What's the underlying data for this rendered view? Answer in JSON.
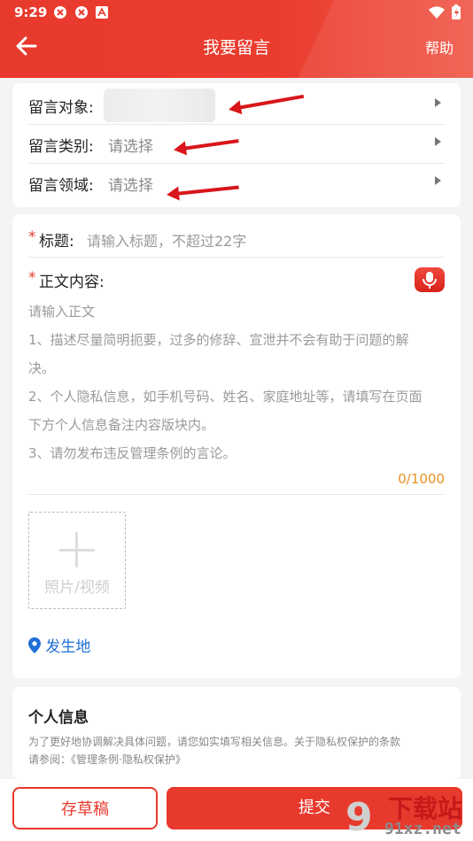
{
  "status_bar": {
    "time": "9:29"
  },
  "nav": {
    "title": "我要留言",
    "help": "帮助"
  },
  "selection": {
    "target_label": "留言对象:",
    "category_label": "留言类别:",
    "category_value": "请选择",
    "domain_label": "留言领域:",
    "domain_value": "请选择"
  },
  "content": {
    "title_label": "标题:",
    "title_placeholder": "请输入标题，不超过22字",
    "body_label": "正文内容:",
    "body_placeholder_lines": [
      "请输入正文",
      "1、描述尽量简明扼要，过多的修辞、宣泄并不会有助于问题的解",
      "决。",
      "2、个人隐私信息，如手机号码、姓名、家庭地址等，请填写在页面",
      "下方个人信息备注内容版块内。",
      "3、请勿发布违反管理条例的言论。"
    ],
    "counter": "0/1000",
    "upload_label": "照片/视频",
    "location_label": "发生地"
  },
  "personal": {
    "title": "个人信息",
    "desc_line1": "为了更好地协调解决具体问题，请您如实填写相关信息。关于隐私权保护的条款",
    "desc_line2": "请参阅：《管理条例·隐私权保护》"
  },
  "footer": {
    "draft": "存草稿",
    "submit": "提交"
  },
  "watermark": {
    "brand": "下载站",
    "domain": "91xz.net"
  },
  "colors": {
    "accent": "#e8392d",
    "annotation_arrow": "#d8161b",
    "link": "#1f6fd6",
    "counter": "#e8911e"
  }
}
